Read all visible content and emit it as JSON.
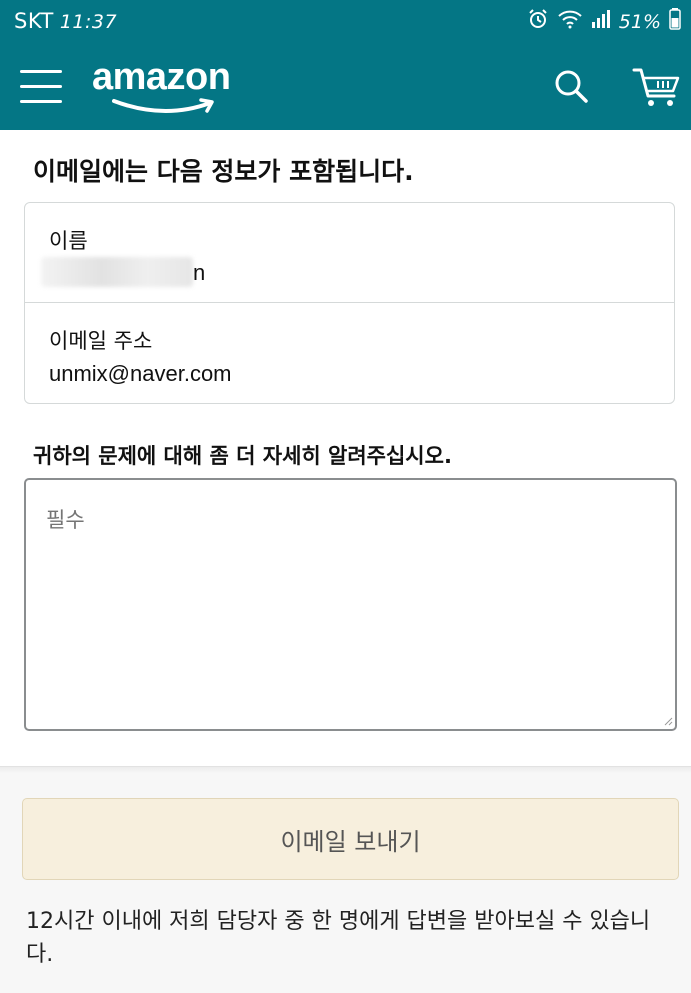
{
  "status_bar": {
    "carrier": "SKT",
    "time": "11:37",
    "battery": "51%"
  },
  "header": {
    "logo_text": "amazon",
    "icons": [
      "menu-icon",
      "search-icon",
      "cart-icon"
    ],
    "background_color": "#047685"
  },
  "form": {
    "section_title": "이메일에는 다음 정보가 포함됩니다.",
    "name_label": "이름",
    "name_value_visible_tail": "n",
    "email_label": "이메일 주소",
    "email_value": "unmix@naver.com",
    "details_label": "귀하의 문제에 대해 좀 더 자세히 알려주십시오.",
    "details_placeholder": "필수",
    "send_button_label": "이메일 보내기",
    "reply_note": "12시간 이내에 저희 담당자 중 한 명에게 답변을 받아보실 수 있습니다."
  }
}
